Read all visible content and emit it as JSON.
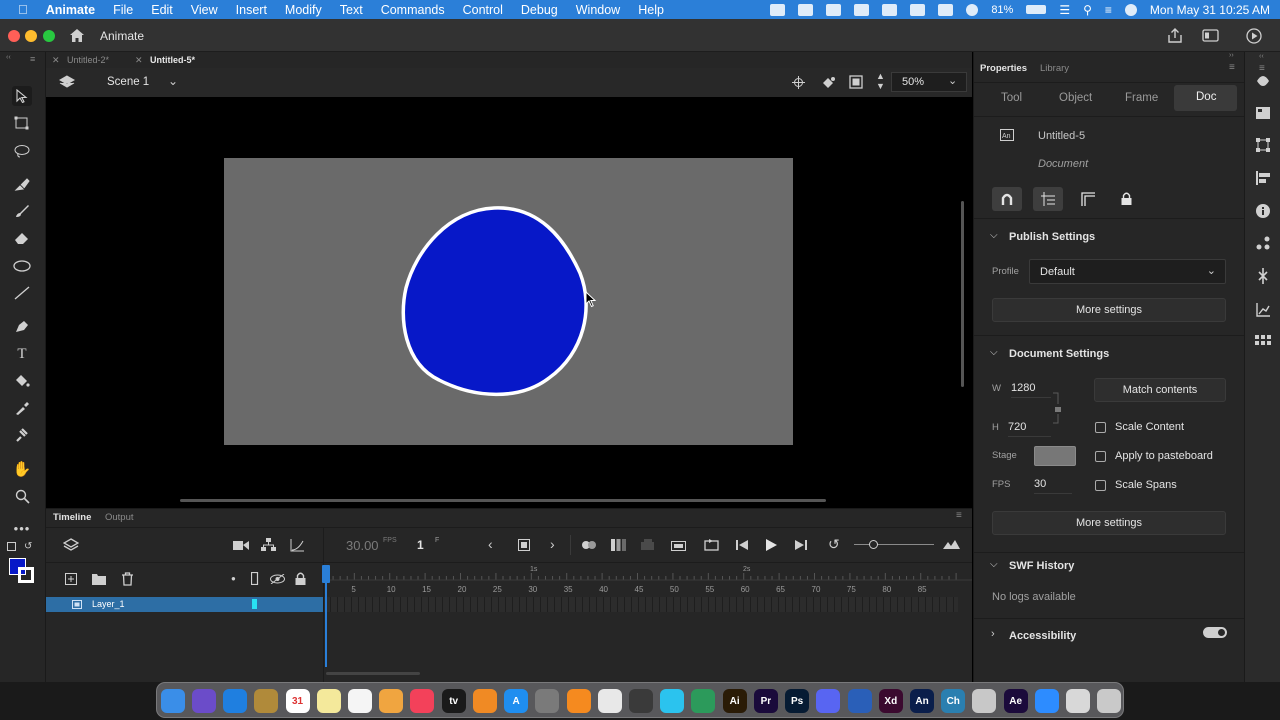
{
  "menubar": {
    "app_name": "Animate",
    "items": [
      "File",
      "Edit",
      "View",
      "Insert",
      "Modify",
      "Text",
      "Commands",
      "Control",
      "Debug",
      "Window",
      "Help"
    ],
    "battery": "81%",
    "clock": "Mon May 31  10:25 AM"
  },
  "titlebar": {
    "title": "Animate"
  },
  "doc_tabs": [
    {
      "label": "Untitled-2*",
      "active": false
    },
    {
      "label": "Untitled-5*",
      "active": true
    }
  ],
  "stagebar": {
    "scene": "Scene 1",
    "zoom": "50%"
  },
  "timeline": {
    "tabs": [
      "Timeline",
      "Output"
    ],
    "fps": "30.00",
    "fps_unit": "FPS",
    "frame": "1",
    "frame_unit": "F",
    "time_marks": [
      "1s",
      "2s"
    ],
    "frame_numbers": [
      "5",
      "10",
      "15",
      "20",
      "25",
      "30",
      "35",
      "40",
      "45",
      "50",
      "55",
      "60",
      "65",
      "70",
      "75",
      "80",
      "85"
    ],
    "layers": [
      {
        "name": "Layer_1",
        "selected": true
      }
    ]
  },
  "properties": {
    "panel_tabs": [
      "Properties",
      "Library"
    ],
    "sub_tabs": [
      "Tool",
      "Object",
      "Frame",
      "Doc"
    ],
    "active_sub_tab": "Doc",
    "doc_name": "Untitled-5",
    "doc_type": "Document",
    "publish": {
      "title": "Publish Settings",
      "profile_label": "Profile",
      "profile_value": "Default",
      "more": "More settings"
    },
    "document": {
      "title": "Document Settings",
      "w_label": "W",
      "w_value": "1280",
      "h_label": "H",
      "h_value": "720",
      "match_contents": "Match contents",
      "scale_content": "Scale Content",
      "apply_pasteboard": "Apply to pasteboard",
      "stage_label": "Stage",
      "fps_label": "FPS",
      "fps_value": "30",
      "scale_spans": "Scale Spans",
      "more": "More settings",
      "stage_color": "#6a6a6a"
    },
    "swf": {
      "title": "SWF History",
      "empty": "No logs available"
    },
    "accessibility": {
      "title": "Accessibility"
    }
  },
  "colors": {
    "fill": "#0718c8",
    "stroke": "#ffffff",
    "stage": "#6a6a6a",
    "menubar": "#2b7fd8",
    "selection": "#2d6ea5"
  },
  "dock": [
    {
      "name": "finder-icon",
      "color": "#3a8ee8",
      "text": ""
    },
    {
      "name": "siri-icon",
      "color": "#6b4cc9",
      "text": ""
    },
    {
      "name": "safari-icon",
      "color": "#1f7fe0",
      "text": ""
    },
    {
      "name": "notes-icon",
      "color": "#b08a3a",
      "text": ""
    },
    {
      "name": "calendar-icon",
      "color": "#ffffff",
      "text": "31"
    },
    {
      "name": "stickies-icon",
      "color": "#f4e99b",
      "text": ""
    },
    {
      "name": "reminders-icon",
      "color": "#f5f5f5",
      "text": ""
    },
    {
      "name": "photos-icon",
      "color": "#f0a540",
      "text": ""
    },
    {
      "name": "music-icon",
      "color": "#f3415a",
      "text": ""
    },
    {
      "name": "appletv-icon",
      "color": "#1a1a1a",
      "text": "tv"
    },
    {
      "name": "books-icon",
      "color": "#f08a24",
      "text": ""
    },
    {
      "name": "appstore-icon",
      "color": "#1f8ef0",
      "text": "A"
    },
    {
      "name": "system-prefs-icon",
      "color": "#7a7a7a",
      "text": ""
    },
    {
      "name": "vlc-icon",
      "color": "#f58a1f",
      "text": ""
    },
    {
      "name": "chrome-icon",
      "color": "#e8e8e8",
      "text": ""
    },
    {
      "name": "remote-icon",
      "color": "#3a3a3a",
      "text": ""
    },
    {
      "name": "filmora-icon",
      "color": "#2bc3ee",
      "text": ""
    },
    {
      "name": "android-icon",
      "color": "#2c9a5b",
      "text": ""
    },
    {
      "name": "illustrator-icon",
      "color": "#2a1b06",
      "text": "Ai"
    },
    {
      "name": "premiere-icon",
      "color": "#1a0a3b",
      "text": "Pr"
    },
    {
      "name": "photoshop-icon",
      "color": "#061b33",
      "text": "Ps"
    },
    {
      "name": "discord-icon",
      "color": "#5865f2",
      "text": ""
    },
    {
      "name": "screen-icon",
      "color": "#2a5fb8",
      "text": ""
    },
    {
      "name": "xd-icon",
      "color": "#3b0a2f",
      "text": "Xd"
    },
    {
      "name": "animate-icon",
      "color": "#0a1e4b",
      "text": "An"
    },
    {
      "name": "character-icon",
      "color": "#2a7fb0",
      "text": "Ch"
    },
    {
      "name": "tools-icon",
      "color": "#c8c8c8",
      "text": ""
    },
    {
      "name": "after-effects-icon",
      "color": "#1b0a3b",
      "text": "Ae"
    },
    {
      "name": "zoom-icon",
      "color": "#2d8cff",
      "text": ""
    },
    {
      "name": "preview-icon",
      "color": "#d8d8d8",
      "text": ""
    },
    {
      "name": "trash-icon",
      "color": "#c9c9c9",
      "text": ""
    }
  ]
}
